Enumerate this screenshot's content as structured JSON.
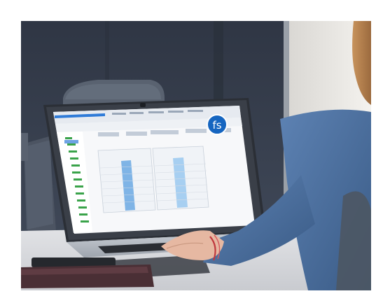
{
  "photo": {
    "subject": "person-working-on-laptop",
    "logo": {
      "text": "fs",
      "color": "#1565c0"
    }
  },
  "colors": {
    "frame": "#ffffff",
    "wall": "#3b4352",
    "screen_bezel": "#2b2f36",
    "laptop_body": "#b9bec6",
    "sleeve": "#4a6f9e",
    "skin": "#e6b8a2",
    "desk": "#dcdde0",
    "window": "#eceae6",
    "hair": "#b9834f"
  }
}
